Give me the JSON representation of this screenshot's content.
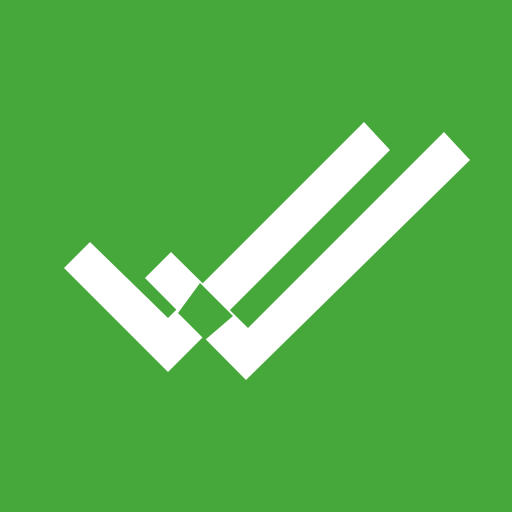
{
  "icon": {
    "name": "double-checkmark-icon",
    "background_color": "#46a83a",
    "mark_color": "#ffffff"
  }
}
